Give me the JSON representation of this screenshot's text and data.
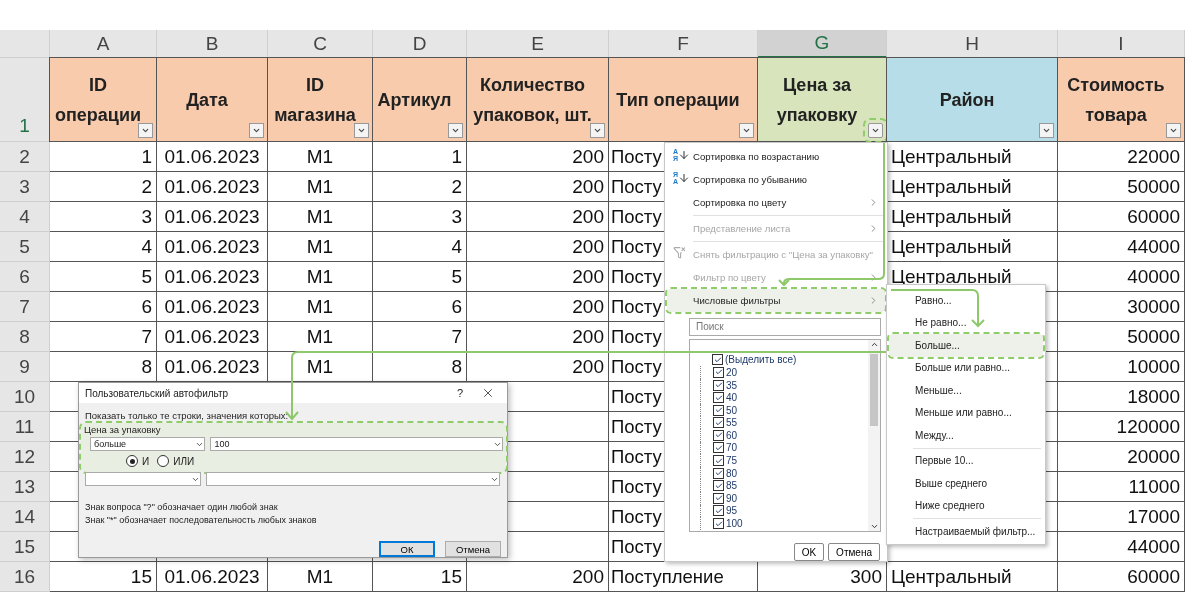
{
  "column_letters": [
    {
      "label": "A",
      "selected": false
    },
    {
      "label": "B",
      "selected": false
    },
    {
      "label": "C",
      "selected": false
    },
    {
      "label": "D",
      "selected": false
    },
    {
      "label": "E",
      "selected": false
    },
    {
      "label": "F",
      "selected": false
    },
    {
      "label": "G",
      "selected": true
    },
    {
      "label": "H",
      "selected": false
    },
    {
      "label": "I",
      "selected": false
    }
  ],
  "header_row_number": "1",
  "headers": [
    {
      "label": "ID операции",
      "color": "#f8cbad",
      "highlighted": false
    },
    {
      "label": "Дата",
      "color": "#f8cbad",
      "highlighted": false
    },
    {
      "label": "ID магазина",
      "color": "#f8cbad",
      "highlighted": false
    },
    {
      "label": "Артикул",
      "color": "#f8cbad",
      "highlighted": false
    },
    {
      "label": "Количество упаковок, шт.",
      "color": "#f8cbad",
      "highlighted": false
    },
    {
      "label": "Тип операции",
      "color": "#f8cbad",
      "highlighted": false
    },
    {
      "label": "Цена за упаковку",
      "color": "#d8e4bc",
      "highlighted": true
    },
    {
      "label": "Район",
      "color": "#b7dee8",
      "highlighted": false
    },
    {
      "label": "Стоимость товара",
      "color": "#f8cbad",
      "highlighted": false
    }
  ],
  "rows": [
    {
      "number": "2",
      "cells": [
        "1",
        "01.06.2023",
        "M1",
        "1",
        "200",
        "Посту",
        null,
        "Центральный",
        "22000"
      ]
    },
    {
      "number": "3",
      "cells": [
        "2",
        "01.06.2023",
        "M1",
        "2",
        "200",
        "Посту",
        null,
        "Центральный",
        "50000"
      ]
    },
    {
      "number": "4",
      "cells": [
        "3",
        "01.06.2023",
        "M1",
        "3",
        "200",
        "Посту",
        null,
        "Центральный",
        "60000"
      ]
    },
    {
      "number": "5",
      "cells": [
        "4",
        "01.06.2023",
        "M1",
        "4",
        "200",
        "Посту",
        null,
        "Центральный",
        "44000"
      ]
    },
    {
      "number": "6",
      "cells": [
        "5",
        "01.06.2023",
        "M1",
        "5",
        "200",
        "Посту",
        null,
        "Центральный",
        "40000"
      ]
    },
    {
      "number": "7",
      "cells": [
        "6",
        "01.06.2023",
        "M1",
        "6",
        "200",
        "Посту",
        null,
        null,
        "30000"
      ]
    },
    {
      "number": "8",
      "cells": [
        "7",
        "01.06.2023",
        "M1",
        "7",
        "200",
        "Посту",
        null,
        null,
        "50000"
      ]
    },
    {
      "number": "9",
      "cells": [
        "8",
        "01.06.2023",
        "M1",
        "8",
        "200",
        "Посту",
        null,
        null,
        "10000"
      ]
    },
    {
      "number": "10",
      "cells": [
        null,
        null,
        null,
        null,
        null,
        "Посту",
        null,
        null,
        "18000"
      ]
    },
    {
      "number": "11",
      "cells": [
        null,
        null,
        null,
        null,
        null,
        "Посту",
        null,
        null,
        "120000"
      ]
    },
    {
      "number": "12",
      "cells": [
        null,
        null,
        null,
        null,
        null,
        "Посту",
        null,
        null,
        "20000"
      ]
    },
    {
      "number": "13",
      "cells": [
        null,
        null,
        null,
        null,
        null,
        "Посту",
        null,
        null,
        "11000"
      ]
    },
    {
      "number": "14",
      "cells": [
        null,
        null,
        null,
        null,
        null,
        "Посту",
        null,
        null,
        "17000"
      ]
    },
    {
      "number": "15",
      "cells": [
        null,
        null,
        null,
        null,
        null,
        "Посту",
        null,
        null,
        "44000"
      ]
    },
    {
      "number": "16",
      "cells": [
        "15",
        "01.06.2023",
        "M1",
        "15",
        "200",
        "Поступление",
        "300",
        "Центральный",
        "60000"
      ]
    }
  ],
  "filter_menu": {
    "items": [
      {
        "kind": "sort_ascending",
        "icon_letters": [
          "А",
          "Я"
        ],
        "label": "Сортировка по возрастанию",
        "disabled": false,
        "submenu": false,
        "highlighted": false
      },
      {
        "kind": "sort_descending",
        "icon_letters": [
          "Я",
          "А"
        ],
        "label": "Сортировка по убыванию",
        "disabled": false,
        "submenu": false,
        "highlighted": false
      },
      {
        "kind": "plain",
        "label": "Сортировка по цвету",
        "disabled": false,
        "submenu": true,
        "highlighted": false
      },
      {
        "kind": "separator"
      },
      {
        "kind": "plain",
        "label": "Представление листа",
        "disabled": true,
        "submenu": true,
        "highlighted": false
      },
      {
        "kind": "separator"
      },
      {
        "kind": "clear_filter",
        "label": "Снять фильтрацию с \"Цена за упаковку\"",
        "disabled": true,
        "submenu": false,
        "highlighted": false
      },
      {
        "kind": "plain",
        "label": "Фильтр по цвету",
        "disabled": true,
        "submenu": true,
        "highlighted": false
      },
      {
        "kind": "plain",
        "label": "Числовые фильтры",
        "disabled": false,
        "submenu": true,
        "highlighted": true
      }
    ],
    "search": {
      "placeholder": "Поиск"
    },
    "values": [
      {
        "kind": "select_all",
        "label": "(Выделить все)",
        "checked": true
      },
      {
        "kind": "value",
        "label": "20",
        "checked": true
      },
      {
        "kind": "value",
        "label": "35",
        "checked": true
      },
      {
        "kind": "value",
        "label": "40",
        "checked": true
      },
      {
        "kind": "value",
        "label": "50",
        "checked": true
      },
      {
        "kind": "value",
        "label": "55",
        "checked": true
      },
      {
        "kind": "value",
        "label": "60",
        "checked": true
      },
      {
        "kind": "value",
        "label": "70",
        "checked": true
      },
      {
        "kind": "value",
        "label": "75",
        "checked": true
      },
      {
        "kind": "value",
        "label": "80",
        "checked": true
      },
      {
        "kind": "value",
        "label": "85",
        "checked": true
      },
      {
        "kind": "value",
        "label": "90",
        "checked": true
      },
      {
        "kind": "value",
        "label": "95",
        "checked": true
      },
      {
        "kind": "value",
        "label": "100",
        "checked": true
      }
    ],
    "buttons": [
      "OK",
      "Отмена"
    ]
  },
  "number_filters_menu": {
    "items": [
      {
        "kind": "item",
        "label": "Равно...",
        "highlighted": false
      },
      {
        "kind": "item",
        "label": "Не равно...",
        "highlighted": false
      },
      {
        "kind": "item",
        "label": "Больше...",
        "highlighted": true
      },
      {
        "kind": "item",
        "label": "Больше или равно...",
        "highlighted": false
      },
      {
        "kind": "item",
        "label": "Меньше...",
        "highlighted": false
      },
      {
        "kind": "item",
        "label": "Меньше или равно...",
        "highlighted": false
      },
      {
        "kind": "item",
        "label": "Между...",
        "highlighted": false
      },
      {
        "kind": "separator"
      },
      {
        "kind": "item",
        "label": "Первые 10...",
        "highlighted": false
      },
      {
        "kind": "item",
        "label": "Выше среднего",
        "highlighted": false
      },
      {
        "kind": "item",
        "label": "Ниже среднего",
        "highlighted": false
      },
      {
        "kind": "separator"
      },
      {
        "kind": "item",
        "label": "Настраиваемый фильтр...",
        "highlighted": false
      }
    ]
  },
  "dialog": {
    "title": "Пользовательский автофильтр",
    "help": "?",
    "prompt": "Показать только те строки, значения которых:",
    "group_label": "Цена за упаковку",
    "group_highlighted": true,
    "conditions": [
      {
        "kind": "filled",
        "operator": "больше",
        "value": "100"
      },
      {
        "kind": "empty"
      }
    ],
    "logic": [
      {
        "label": "И",
        "selected": true
      },
      {
        "label": "ИЛИ",
        "selected": false
      }
    ],
    "hints": [
      "Знак вопроса \"?\" обозначает один любой знак",
      "Знак \"*\" обозначает последовательность любых знаков"
    ],
    "buttons": [
      {
        "label": "ОК",
        "default": true
      },
      {
        "label": "Отмена",
        "default": false
      }
    ]
  }
}
